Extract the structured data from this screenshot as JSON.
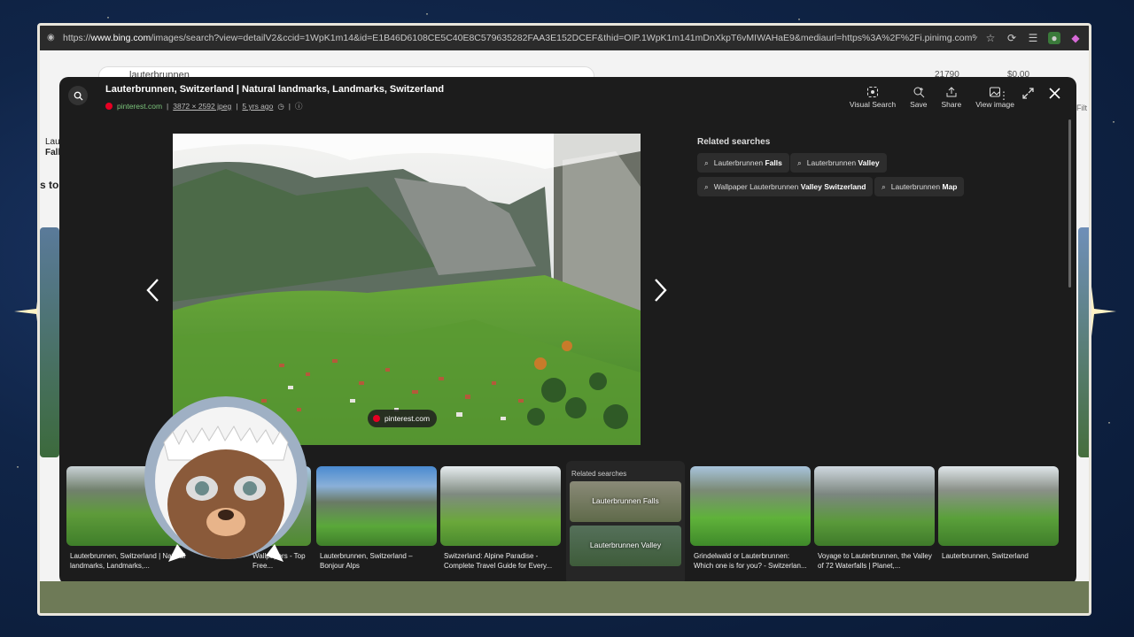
{
  "address_bar": {
    "url_prefix": "https://",
    "url_domain": "www.bing.com",
    "url_rest": "/images/search?view=detailV2&ccid=1WpK1m14&id=E1B46D6108CE5C40E8C579635282FAA3E152DCEF&thid=OIP.1WpK1m141mDnXkpT6vMIWAHaE9&mediaurl=https%3A%2F%2Fi.pinimg.com%2Foriginals%2F66%2Fc3..."
  },
  "bing": {
    "search_value": "lauterbrunnen",
    "points": "21790",
    "reward": "$0.00",
    "side_label_1": "Laut",
    "side_label_2": "Fall",
    "side_label_3": "s to",
    "side_label_4": "Filt"
  },
  "overlay": {
    "title": "Lauterbrunnen, Switzerland | Natural landmarks, Landmarks, Switzerland",
    "source": "pinterest.com",
    "dimensions": "3872 × 2592 jpeg",
    "age": "5 yrs ago",
    "actions": [
      {
        "label": "Visual Search",
        "icon": "visual-search-icon"
      },
      {
        "label": "Save",
        "icon": "save-icon"
      },
      {
        "label": "Share",
        "icon": "share-icon"
      },
      {
        "label": "View image",
        "icon": "view-image-icon"
      }
    ],
    "image_badge": "pinterest.com",
    "related_title": "Related searches",
    "chips": [
      {
        "plain": "Lauterbrunnen ",
        "bold": "Falls"
      },
      {
        "plain": "Lauterbrunnen ",
        "bold": "Valley"
      },
      {
        "plain": "Wallpaper Lauterbrunnen ",
        "bold": "Valley Switzerland"
      },
      {
        "plain": "Lauterbrunnen ",
        "bold": "Map"
      }
    ]
  },
  "strip": {
    "thumbs": [
      {
        "caption": "Lauterbrunnen, Switzerland | Natural landmarks, Landmarks,..."
      },
      {
        "caption": "Wallpapers - Top Free..."
      },
      {
        "caption": "Lauterbrunnen, Switzerland – Bonjour Alps"
      },
      {
        "caption": "Switzerland: Alpine Paradise - Complete Travel Guide for Every..."
      },
      {
        "caption": "Grindelwald or Lauterbrunnen: Which one is for you? - Switzerlan..."
      },
      {
        "caption": "Voyage to Lauterbrunnen, the Valley of 72 Waterfalls | Planet,..."
      },
      {
        "caption": "Lauterbrunnen, Switzerland"
      }
    ],
    "related_card": {
      "title": "Related searches",
      "tiles": [
        "Lauterbrunnen Falls",
        "Lauterbrunnen Valley"
      ]
    }
  },
  "colors": {
    "accent_green": "#7bc47b",
    "pinterest_red": "#e60023",
    "frame": "#e9e6dc"
  }
}
